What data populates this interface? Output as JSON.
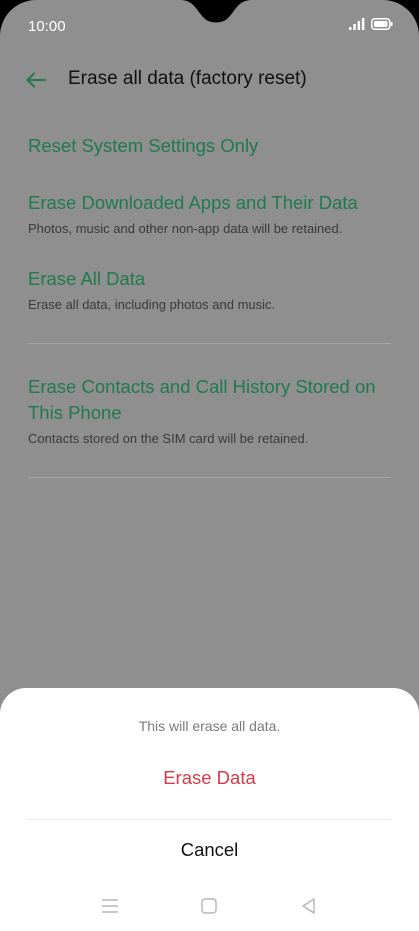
{
  "status_bar": {
    "time": "10:00",
    "icons": [
      "signal-icon",
      "battery-icon"
    ]
  },
  "app_bar": {
    "back_icon": "back-arrow-icon",
    "title": "Erase all data (factory reset)"
  },
  "options": [
    {
      "title": "Reset System Settings Only",
      "description": ""
    },
    {
      "title": "Erase Downloaded Apps and Their Data",
      "description": "Photos, music and other non-app data will be retained."
    },
    {
      "title": "Erase All Data",
      "description": "Erase all data, including photos and music."
    },
    {
      "title": "Erase Contacts and Call History Stored on This Phone",
      "description": "Contacts stored on the SIM card will be retained."
    }
  ],
  "dialog": {
    "message": "This will erase all data.",
    "confirm_label": "Erase Data",
    "cancel_label": "Cancel"
  },
  "nav_bar": {
    "icons": [
      "menu-icon",
      "home-icon",
      "back-triangle-icon"
    ]
  },
  "colors": {
    "accent": "#1f7a4d",
    "danger": "#d9384a",
    "scrim": "#8f8f8f"
  }
}
